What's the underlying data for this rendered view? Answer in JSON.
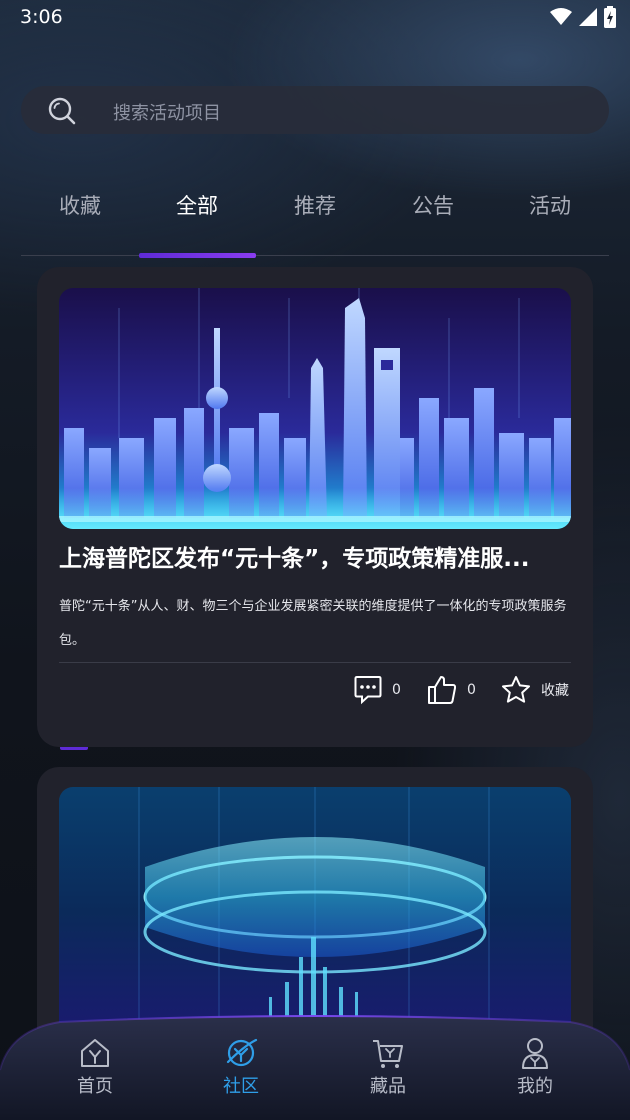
{
  "status_bar": {
    "time": "3:06"
  },
  "search": {
    "placeholder": "搜索活动项目"
  },
  "tabs": [
    {
      "label": "收藏",
      "active": false
    },
    {
      "label": "全部",
      "active": true
    },
    {
      "label": "推荐",
      "active": false
    },
    {
      "label": "公告",
      "active": false
    },
    {
      "label": "活动",
      "active": false
    }
  ],
  "posts": [
    {
      "title": "上海普陀区发布“元十条”，专项政策精准服...",
      "description": "普陀“元十条”从人、财、物三个与企业发展紧密关联的维度提供了一体化的专项政策服务包。",
      "comments": "0",
      "likes": "0",
      "favorite_label": "收藏"
    }
  ],
  "bottom_nav": [
    {
      "label": "首页",
      "icon": "home-icon",
      "active": false
    },
    {
      "label": "社区",
      "icon": "community-icon",
      "active": true
    },
    {
      "label": "藏品",
      "icon": "cart-icon",
      "active": false
    },
    {
      "label": "我的",
      "icon": "profile-icon",
      "active": false
    }
  ],
  "colors": {
    "accent": "#2f9ee8",
    "tab_indicator": "#6a33e0",
    "card_background": "#21222c"
  }
}
